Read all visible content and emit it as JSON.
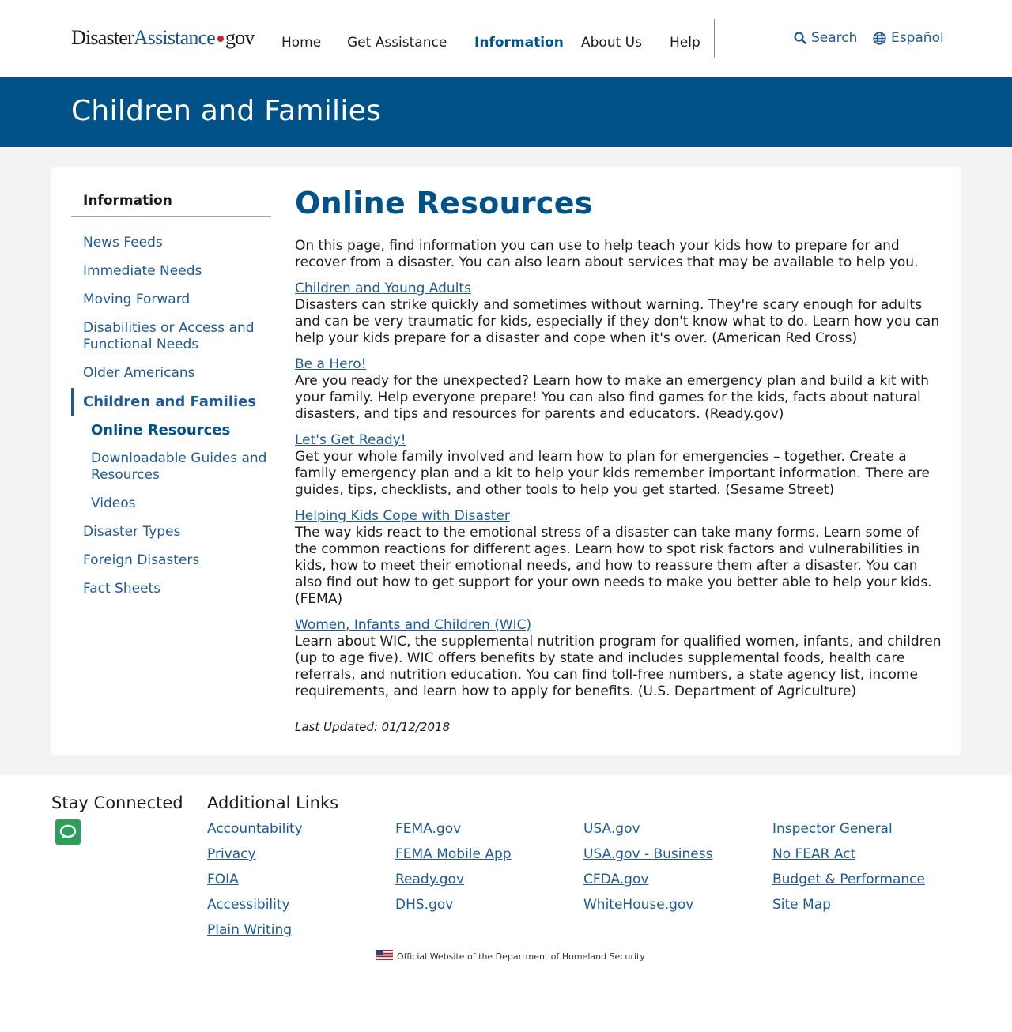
{
  "logo": {
    "part1": "Disaster",
    "part2": "Assistance",
    "part3": "gov"
  },
  "nav": {
    "items": [
      {
        "label": "Home"
      },
      {
        "label": "Get Assistance"
      },
      {
        "label": "Information"
      },
      {
        "label": "About Us"
      },
      {
        "label": "Help"
      }
    ],
    "active": "Information",
    "search_label": "Search",
    "language_label": "Español"
  },
  "banner": {
    "title": "Children and Families"
  },
  "sidenav": {
    "heading": "Information",
    "items": [
      {
        "label": "News Feeds"
      },
      {
        "label": "Immediate Needs"
      },
      {
        "label": "Moving Forward"
      },
      {
        "label": "Disabilities or Access and Functional Needs"
      },
      {
        "label": "Older Americans"
      },
      {
        "label": "Children and Families"
      },
      {
        "label": "Online Resources"
      },
      {
        "label": "Downloadable Guides and Resources"
      },
      {
        "label": "Videos"
      },
      {
        "label": "Disaster Types"
      },
      {
        "label": "Foreign Disasters"
      },
      {
        "label": "Fact Sheets"
      }
    ]
  },
  "content": {
    "title": "Online Resources",
    "intro": "On this page, find information you can use to help teach your kids how to prepare for and recover from a disaster. You can also learn about services that may be available to help you.",
    "resources": [
      {
        "link": "Children and Young Adults",
        "description": "Disasters can strike quickly and sometimes without warning. They're scary enough for adults and can be very traumatic for kids, especially if they don't know what to do. Learn how you can help your kids prepare for a disaster and cope when it's over. (American Red Cross)"
      },
      {
        "link": "Be a Hero!",
        "description": "Are you ready for the unexpected? Learn how to make an emergency plan and build a kit with your family. Help everyone prepare! You can also find games for the kids, facts about natural disasters, and tips and resources for parents and educators. (Ready.gov)"
      },
      {
        "link": "Let's Get Ready!",
        "description": "Get your whole family involved and learn how to plan for emergencies – together. Create a family emergency plan and a kit to help your kids remember important information. There are guides, tips, checklists, and other tools to help you get started. (Sesame Street)"
      },
      {
        "link": "Helping Kids Cope with Disaster",
        "description": "The way kids react to the emotional stress of a disaster can take many forms. Learn some of the common reactions for different ages. Learn how to spot risk factors and vulnerabilities in kids, how to meet their emotional needs, and how to reassure them after a disaster. You can also find out how to get support for your own needs to make you better able to help your kids. (FEMA)"
      },
      {
        "link": "Women, Infants and Children (WIC)",
        "description": "Learn about WIC, the supplemental nutrition program for qualified women, infants, and children (up to age five). WIC offers benefits by state and includes supplemental foods, health care referrals, and nutrition education. You can find toll-free numbers, a state agency list, income requirements, and learn how to apply for benefits. (U.S. Department of Agriculture)"
      }
    ],
    "last_updated": "Last Updated: 01/12/2018"
  },
  "footer": {
    "stay_connected": "Stay Connected",
    "additional_links": "Additional Links",
    "columns": [
      [
        "Accountability",
        "Privacy",
        "FOIA",
        "Accessibility",
        "Plain Writing"
      ],
      [
        "FEMA.gov",
        "FEMA Mobile App",
        "Ready.gov",
        "DHS.gov"
      ],
      [
        "USA.gov",
        "USA.gov - Business",
        "CFDA.gov",
        "WhiteHouse.gov"
      ],
      [
        "Inspector General",
        "No FEAR Act",
        "Budget & Performance",
        "Site Map"
      ]
    ],
    "official": "Official Website of the Department of Homeland Security"
  },
  "colors": {
    "brand_blue": "#005288",
    "link_blue": "#1f5a96",
    "logo_red": "#d61f26",
    "chat_green": "#2e9e5b"
  },
  "icons": {
    "search": "search-icon",
    "language": "globe-icon",
    "chat": "chat-icon",
    "flag": "us-flag-icon"
  }
}
